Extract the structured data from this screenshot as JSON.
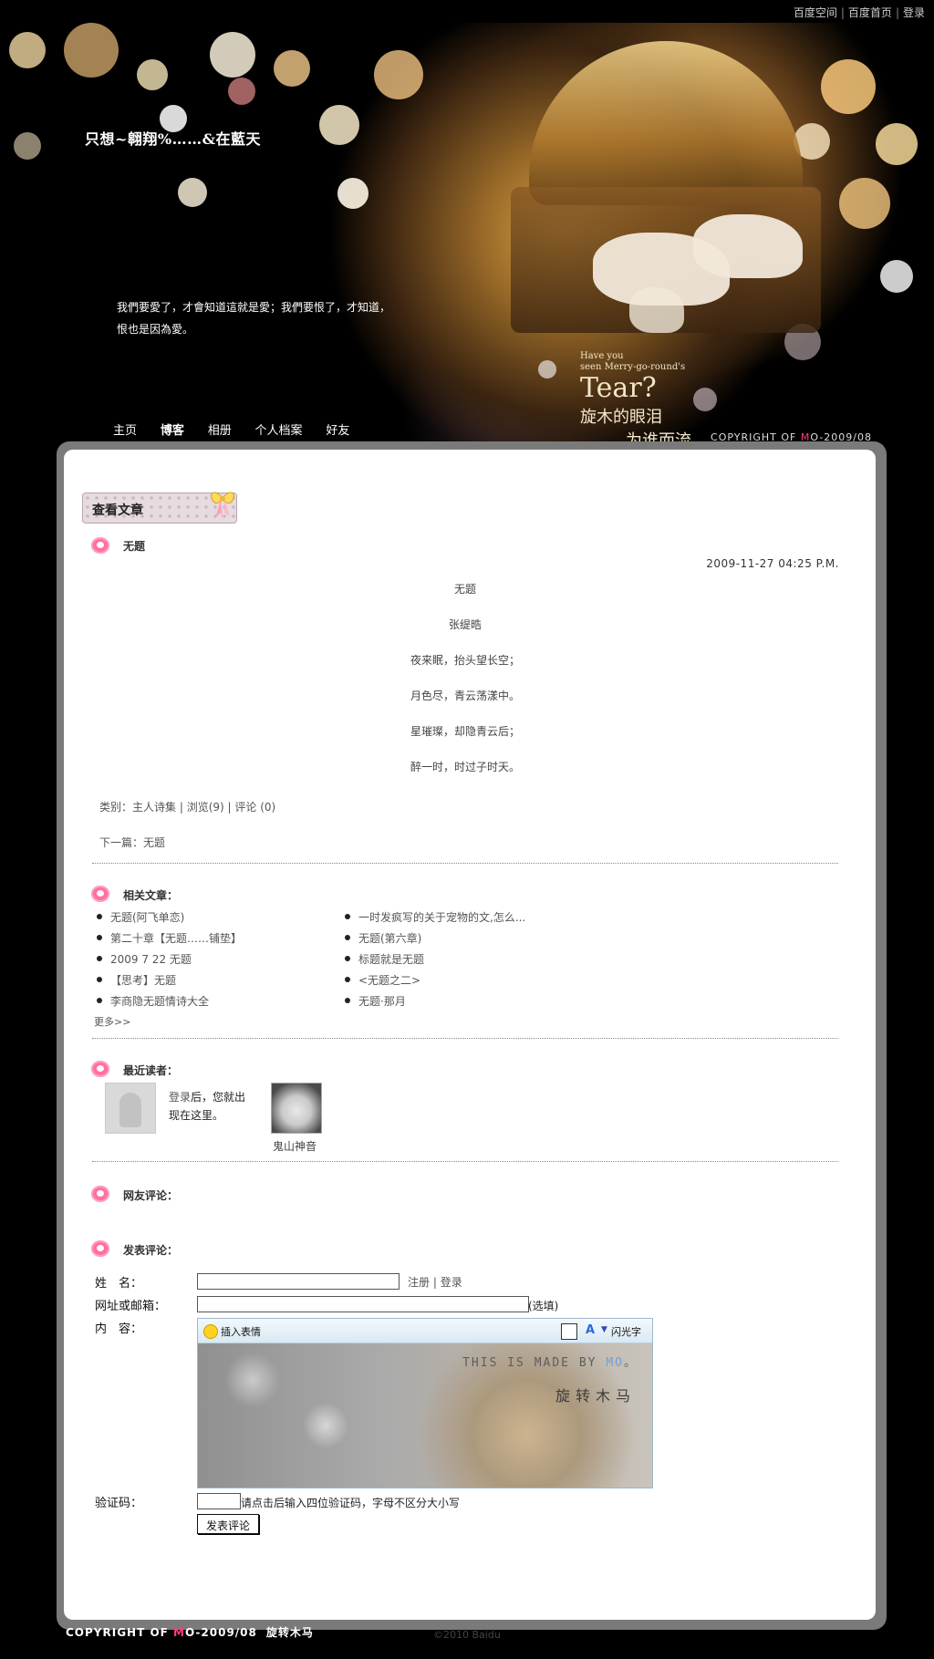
{
  "topbar": {
    "links": [
      "百度空间",
      "百度首页",
      "登录"
    ]
  },
  "header": {
    "site_title": "只想~翱翔%……&在藍天",
    "description": "我們要愛了，才會知道這就是愛；我們要恨了，才知道，恨也是因為愛。",
    "art_line1": "Have you",
    "art_line2": "seen Merry-go-round's",
    "art_line3": "Tear?",
    "art_line4": "旋木的眼泪",
    "art_line5": "为谁而流",
    "copyright_pre": "COPYRIGHT OF ",
    "copyright_m": "M",
    "copyright_post": "O-2009/08"
  },
  "nav": {
    "items": [
      "主页",
      "博客",
      "相册",
      "个人档案",
      "好友"
    ],
    "active": "博客"
  },
  "section": {
    "tab_label": "查看文章"
  },
  "post": {
    "title": "无题",
    "date": "2009-11-27 04:25 P.M.",
    "lines": [
      "无题",
      "张缇晧",
      "夜来眠，抬头望长空；",
      "月色尽，青云荡漾中。",
      "星璀璨，却隐青云后；",
      "醉一时，时过子时天。"
    ],
    "category": "类别：主人诗集",
    "views": "浏览(9)",
    "comments": "评论 (0)",
    "next": "下一篇：无题"
  },
  "related": {
    "heading": "相关文章：",
    "left": [
      "无题(阿飞单恋)",
      "第二十章【无题……铺垫】",
      "2009 7 22 无题",
      "【思考】无题",
      "李商隐无题情诗大全"
    ],
    "right": [
      "一时发疯写的关于宠物的文,怎么...",
      "无题(第六章)",
      "标题就是无题",
      "<无题之二>",
      "无题·那月"
    ],
    "more": "更多>>"
  },
  "readers": {
    "heading": "最近读者：",
    "login_link": "登录",
    "login_rest": "后，您就出现在这里。",
    "user_name": "鬼山神音"
  },
  "comments": {
    "heading": "网友评论："
  },
  "form": {
    "heading": "发表评论：",
    "name_label": "姓　名：",
    "register": "注册",
    "sep": "|",
    "login": "登录",
    "url_label": "网址或邮箱：",
    "optional": "(选填)",
    "content_label": "内　容：",
    "insert_emoticon": "插入表情",
    "flash_text": "闪光字",
    "editor_watermark": "THIS IS MADE BY ",
    "editor_watermark_m": "MO",
    "editor_watermark_end": "。",
    "editor_watermark2": "旋转木马",
    "captcha_label": "验证码：",
    "captcha_hint": "请点击后输入四位验证码，字母不区分大小写",
    "submit": "发表评论"
  },
  "footer": {
    "copyright_pre": "COPYRIGHT OF ",
    "copyright_m": "M",
    "copyright_post": "O-2009/08",
    "cn": "旋转木马",
    "baidu": "©2010 Baidu"
  }
}
